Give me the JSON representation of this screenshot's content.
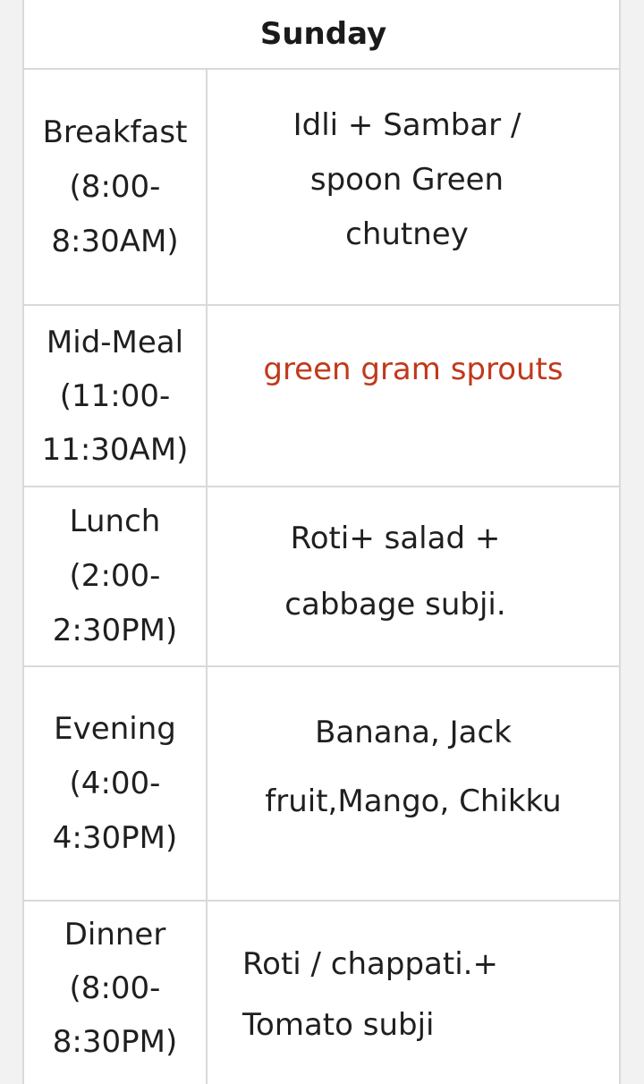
{
  "header": {
    "day": "Sunday"
  },
  "rows": [
    {
      "meal": "Breakfast",
      "time_start": "(8:00-",
      "time_end": "8:30AM)",
      "menu": "Idli + Sambar  /\nspoon Green\nchutney"
    },
    {
      "meal": "Mid-Meal",
      "time_start": "(11:00-",
      "time_end": "11:30AM)",
      "menu": "green gram sprouts"
    },
    {
      "meal": "Lunch",
      "time_start": "(2:00-",
      "time_end": "2:30PM)",
      "menu": "Roti+   salad +\ncabbage subji."
    },
    {
      "meal": "Evening",
      "time_start": "(4:00-",
      "time_end": "4:30PM)",
      "menu": "Banana, Jack\nfruit,Mango, Chikku"
    },
    {
      "meal": "Dinner",
      "time_start": "(8:00-",
      "time_end": "8:30PM)",
      "menu": "Roti / chappati.+\nTomato subji"
    }
  ],
  "colors": {
    "highlight_text": "#c0391b",
    "grid_line": "#d9d9d9"
  }
}
